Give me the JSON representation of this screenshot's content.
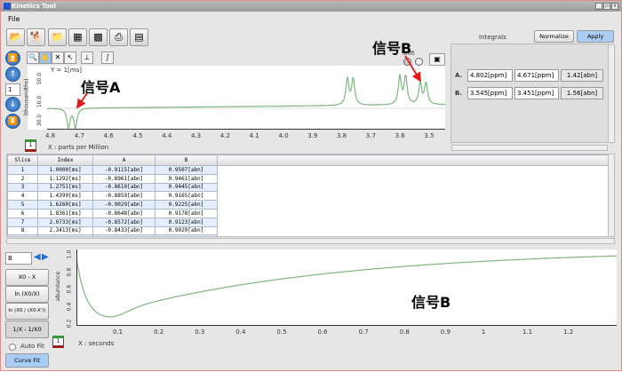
{
  "window": {
    "title": "Kinetics Tool",
    "controls": [
      "_",
      "▫",
      "x"
    ]
  },
  "menu": {
    "file": "File"
  },
  "toolbar": {
    "icons": [
      "open-folder-icon",
      "import-icon",
      "open-recent-icon",
      "export-icon",
      "analyze-icon",
      "print-icon",
      "print-preview-icon"
    ]
  },
  "subtoolbar": {
    "icons": [
      "zoom-icon",
      "pan-icon",
      "cross-icon",
      "select-icon",
      "baseline-icon",
      "integral-icon"
    ]
  },
  "nav": {
    "slice_value": "1"
  },
  "spectrum": {
    "y_label": "Y = 1[ms]",
    "y_axis_label": "(thousandths)",
    "y_ticks": [
      "50.0",
      "10.0",
      "30.0"
    ],
    "x_ticks": [
      "4.8",
      "4.7",
      "4.6",
      "4.5",
      "4.4",
      "4.3",
      "4.2",
      "4.1",
      "4.0",
      "3.9",
      "3.8",
      "3.7",
      "3.6",
      "3.5"
    ],
    "x_label": "X : parts per Million",
    "shift_label": "Shift",
    "trace_color": "#7fb57f",
    "slice_badge": "1"
  },
  "annotations": {
    "signal_a": "信号A",
    "signal_b_top": "信号B",
    "signal_b_bottom": "信号B",
    "arrow_color": "#e51a1a"
  },
  "integrals": {
    "title": "Integrals",
    "normalize": "Normalize",
    "apply": "Apply",
    "rows": [
      {
        "label": "A.",
        "start": "4.802[ppm]",
        "end": "4.671[ppm]",
        "value": "1.42[abn]"
      },
      {
        "label": "B.",
        "start": "3.545[ppm]",
        "end": "3.451[ppm]",
        "value": "1.56[abn]"
      }
    ]
  },
  "table": {
    "columns": [
      "Slice",
      "Index",
      "A",
      "B"
    ],
    "rows": [
      [
        "1",
        "1.0000[ms]",
        "-0.9115[abn]",
        "0.9507[abn]"
      ],
      [
        "2",
        "1.1292[ms]",
        "-0.8961[abn]",
        "0.9461[abn]"
      ],
      [
        "3",
        "1.2751[ms]",
        "-0.8610[abn]",
        "0.9445[abn]"
      ],
      [
        "4",
        "1.4399[ms]",
        "-0.8859[abn]",
        "0.9165[abn]"
      ],
      [
        "5",
        "1.6260[ms]",
        "-0.9029[abn]",
        "0.9225[abn]"
      ],
      [
        "6",
        "1.8361[ms]",
        "-0.8648[abn]",
        "0.9178[abn]"
      ],
      [
        "7",
        "2.0733[ms]",
        "-0.8572[abn]",
        "0.9123[abn]"
      ],
      [
        "8",
        "2.3413[ms]",
        "-0.8433[abn]",
        "0.9029[abn]"
      ],
      [
        "9",
        "2.6438[ms]",
        "-0.8273[abn]",
        "0.8960[abn]"
      ]
    ]
  },
  "fit": {
    "signal_value": "B",
    "buttons": [
      "X0 - X",
      "ln (X0/X)",
      "ln (X0 / (X0-X'))",
      "1/X - 1/X0"
    ],
    "auto_fit": "Auto Fit",
    "auto_fit_checked": false,
    "curve_fit": "Curve Fit"
  },
  "decay": {
    "y_axis_label": "abundance",
    "y_ticks": [
      "1.0",
      "0.8",
      "0.6",
      "0.4",
      "0.2"
    ],
    "x_ticks": [
      "0.1",
      "0.2",
      "0.3",
      "0.4",
      "0.5",
      "0.6",
      "0.7",
      "0.8",
      "0.9",
      "1",
      "1.1",
      "1.2"
    ],
    "x_label": "X : seconds",
    "slice_badge": "1",
    "trace_color": "#7fb57f"
  }
}
